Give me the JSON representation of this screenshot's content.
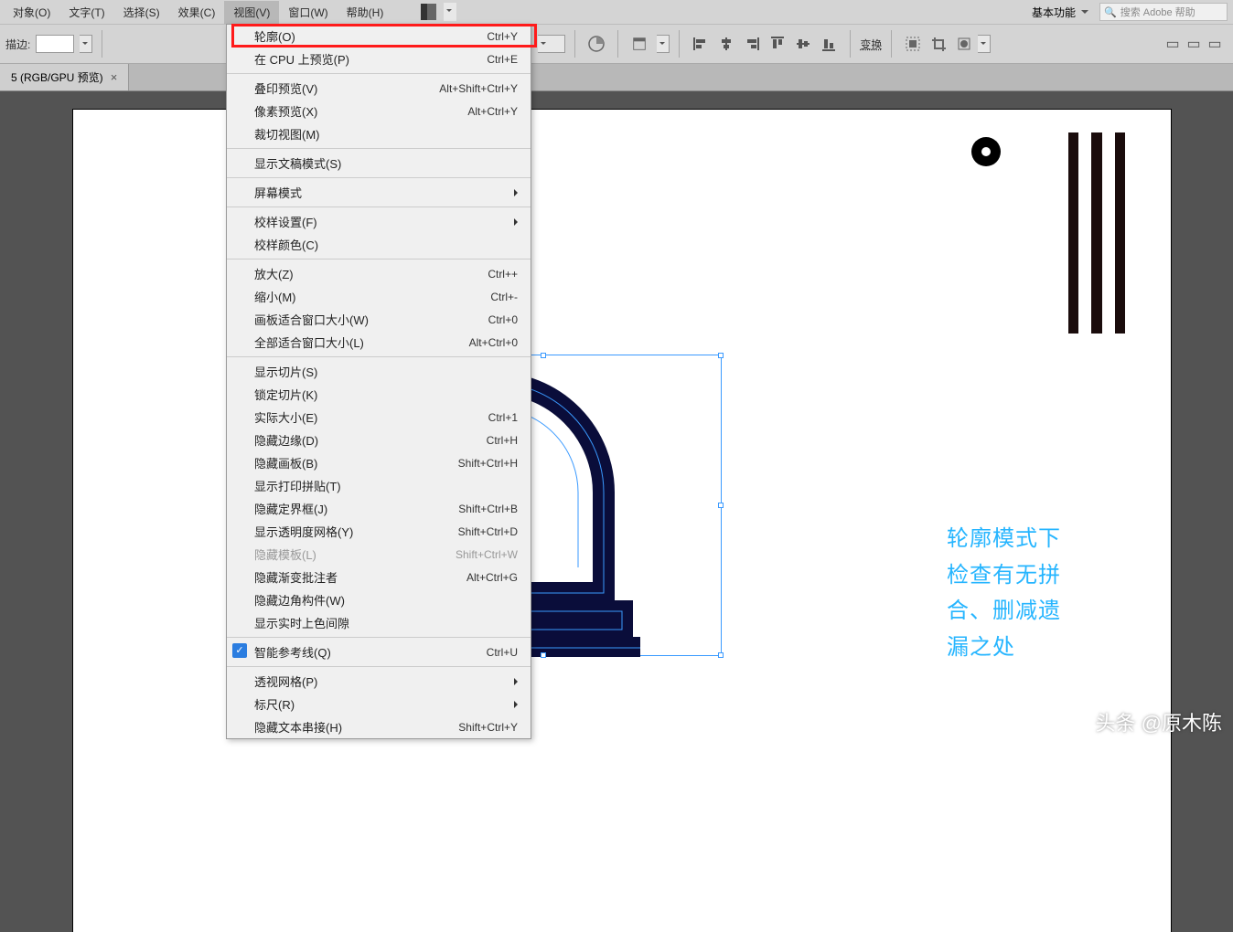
{
  "menubar": {
    "items": [
      "对象(O)",
      "文字(T)",
      "选择(S)",
      "效果(C)",
      "视图(V)",
      "窗口(W)",
      "帮助(H)"
    ],
    "active_index": 4,
    "workspace": "基本功能",
    "search_placeholder": "搜索 Adobe 帮助"
  },
  "toolbar": {
    "stroke_label": "描边:"
  },
  "tab": {
    "title": "5 (RGB/GPU 预览)"
  },
  "dropdown": {
    "groups": [
      [
        {
          "label": "轮廓(O)",
          "shortcut": "Ctrl+Y",
          "highlight": true
        },
        {
          "label": "在 CPU 上预览(P)",
          "shortcut": "Ctrl+E"
        }
      ],
      [
        {
          "label": "叠印预览(V)",
          "shortcut": "Alt+Shift+Ctrl+Y"
        },
        {
          "label": "像素预览(X)",
          "shortcut": "Alt+Ctrl+Y"
        },
        {
          "label": "裁切视图(M)",
          "shortcut": ""
        }
      ],
      [
        {
          "label": "显示文稿模式(S)",
          "shortcut": ""
        }
      ],
      [
        {
          "label": "屏幕模式",
          "shortcut": "",
          "submenu": true
        }
      ],
      [
        {
          "label": "校样设置(F)",
          "shortcut": "",
          "submenu": true
        },
        {
          "label": "校样颜色(C)",
          "shortcut": ""
        }
      ],
      [
        {
          "label": "放大(Z)",
          "shortcut": "Ctrl++"
        },
        {
          "label": "缩小(M)",
          "shortcut": "Ctrl+-"
        },
        {
          "label": "画板适合窗口大小(W)",
          "shortcut": "Ctrl+0"
        },
        {
          "label": "全部适合窗口大小(L)",
          "shortcut": "Alt+Ctrl+0"
        }
      ],
      [
        {
          "label": "显示切片(S)",
          "shortcut": ""
        },
        {
          "label": "锁定切片(K)",
          "shortcut": ""
        },
        {
          "label": "实际大小(E)",
          "shortcut": "Ctrl+1"
        },
        {
          "label": "隐藏边缘(D)",
          "shortcut": "Ctrl+H"
        },
        {
          "label": "隐藏画板(B)",
          "shortcut": "Shift+Ctrl+H"
        },
        {
          "label": "显示打印拼贴(T)",
          "shortcut": ""
        },
        {
          "label": "隐藏定界框(J)",
          "shortcut": "Shift+Ctrl+B"
        },
        {
          "label": "显示透明度网格(Y)",
          "shortcut": "Shift+Ctrl+D"
        },
        {
          "label": "隐藏模板(L)",
          "shortcut": "Shift+Ctrl+W",
          "disabled": true
        },
        {
          "label": "隐藏渐变批注者",
          "shortcut": "Alt+Ctrl+G"
        },
        {
          "label": "隐藏边角构件(W)",
          "shortcut": ""
        },
        {
          "label": "显示实时上色间隙",
          "shortcut": ""
        }
      ],
      [
        {
          "label": "智能参考线(Q)",
          "shortcut": "Ctrl+U",
          "checked": true
        }
      ],
      [
        {
          "label": "透视网格(P)",
          "shortcut": "",
          "submenu": true
        },
        {
          "label": "标尺(R)",
          "shortcut": "",
          "submenu": true
        },
        {
          "label": "隐藏文本串接(H)",
          "shortcut": "Shift+Ctrl+Y"
        }
      ]
    ]
  },
  "annotation": {
    "line1": "轮廓模式下",
    "line2": "检查有无拼",
    "line3": "合、删减遗",
    "line4": "漏之处"
  },
  "transform_label": "变换",
  "watermark": "头条 @原木陈"
}
